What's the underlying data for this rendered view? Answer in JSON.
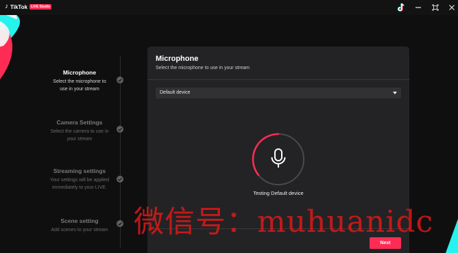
{
  "titlebar": {
    "app_name": "TikTok",
    "app_badge": "LIVE Studio"
  },
  "steps": [
    {
      "title": "Microphone",
      "desc": "Select the microphone to use in your stream",
      "state": "active"
    },
    {
      "title": "Camera Settings",
      "desc": "Select the camera to use in your stream",
      "state": "inactive"
    },
    {
      "title": "Streaming settings",
      "desc": "Your settings will be applied immediately to your LIVE.",
      "state": "inactive"
    },
    {
      "title": "Scene setting",
      "desc": "Add scenes to your stream",
      "state": "inactive"
    }
  ],
  "panel": {
    "title": "Microphone",
    "subtitle": "Select the microphone to use in your stream",
    "device_select": "Default device",
    "testing_text": "Testing Default device",
    "next_label": "Next"
  },
  "watermark": "微信号：muhuanidc",
  "colors": {
    "accent": "#fe2c55",
    "cyan": "#25f4ee",
    "panel_bg": "#232325",
    "page_bg": "#0f0f10"
  },
  "icons": [
    "tiktok-note-icon",
    "minimize-icon",
    "maximize-icon",
    "close-icon",
    "check-icon",
    "dropdown-arrow-icon",
    "microphone-icon"
  ]
}
